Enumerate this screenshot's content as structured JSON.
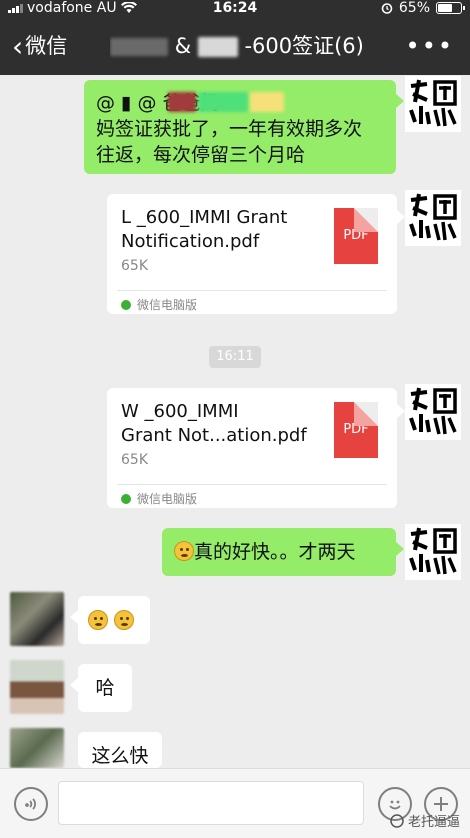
{
  "status_bar": {
    "carrier": "vodafone AU",
    "time": "16:24",
    "battery_text": "65%",
    "battery_level": 0.65
  },
  "nav": {
    "back_label": "微信",
    "title_prefix": "&",
    "title_suffix": "-600签证(6)",
    "more_icon": "more-icon"
  },
  "messages": [
    {
      "type": "text",
      "side": "right",
      "lines": [
        "@ ▮ @                          爸爸妈",
        "妈签证获批了，一年有效期多次",
        "往返，每次停留三个月哈"
      ]
    },
    {
      "type": "file",
      "side": "right",
      "filename_line1": "L      _600_IMMI Grant",
      "filename_line2": "Notification.pdf",
      "size": "65K",
      "source": "微信电脑版",
      "badge": "PDF"
    },
    {
      "type": "time",
      "text": "16:11"
    },
    {
      "type": "file",
      "side": "right",
      "filename_line1": "W      _600_IMMI",
      "filename_line2": "Grant Not...ation.pdf",
      "size": "65K",
      "source": "微信电脑版",
      "badge": "PDF"
    },
    {
      "type": "text",
      "side": "right",
      "text": "真的好快。。才两天"
    },
    {
      "type": "emoji",
      "side": "left"
    },
    {
      "type": "text",
      "side": "left",
      "text": "哈"
    },
    {
      "type": "text",
      "side": "left",
      "text": "这么快"
    }
  ],
  "watermark": "老托逼逼",
  "colors": {
    "header_bg": "#2f2f2f",
    "chat_bg": "#ededed",
    "bubble_green": "#95ec69",
    "pdf_red": "#e64340"
  }
}
